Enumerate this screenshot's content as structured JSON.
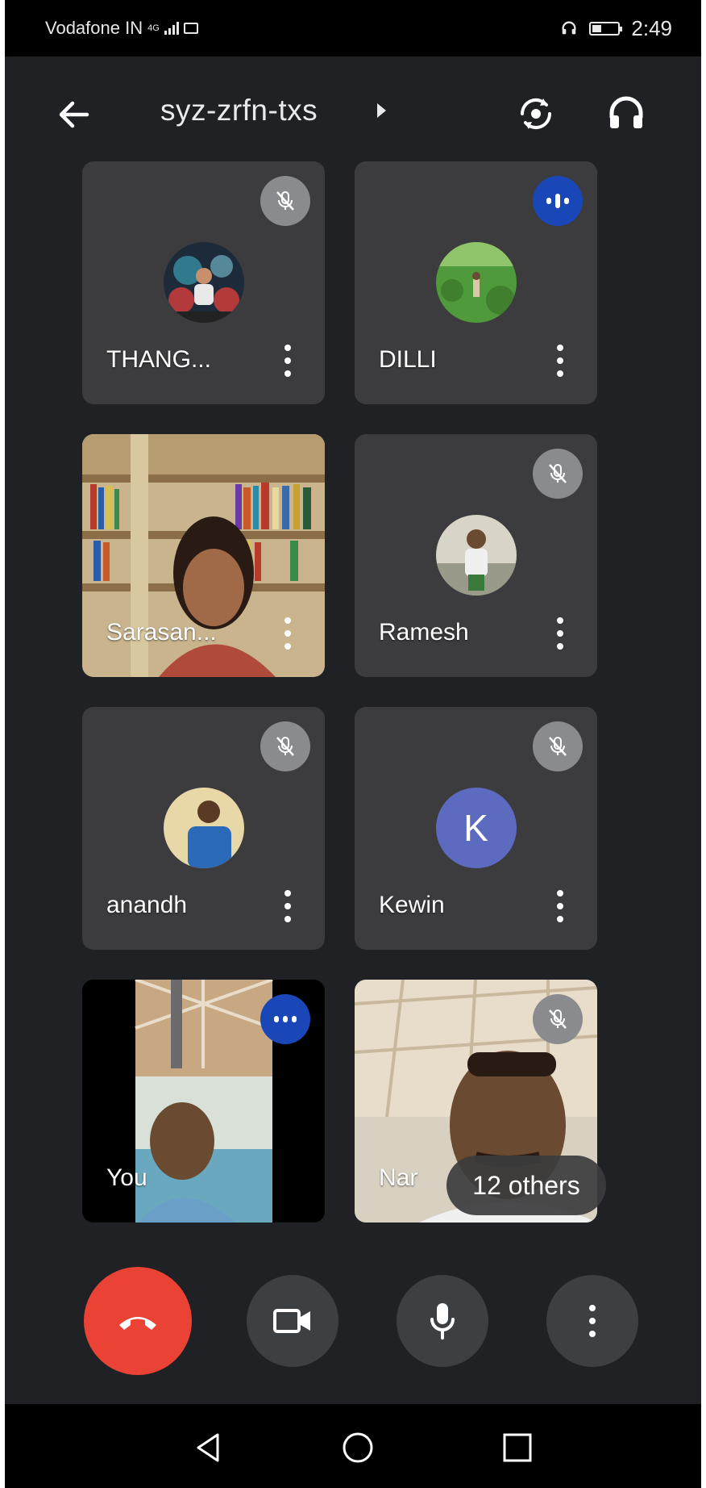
{
  "status_bar": {
    "carrier": "Vodafone IN",
    "network_type": "4G",
    "time": "2:49",
    "battery_level": 0.35
  },
  "top_bar": {
    "meeting_code": "syz-zrfn-txs",
    "icons": [
      "back-arrow-icon",
      "switch-camera-icon",
      "audio-output-icon"
    ]
  },
  "participants": [
    {
      "name": "THANG...",
      "status": "muted",
      "media": "profile-photo"
    },
    {
      "name": "DILLI",
      "status": "speaking",
      "media": "profile-photo"
    },
    {
      "name": "Sarasan...",
      "status": "unmuted",
      "media": "video"
    },
    {
      "name": "Ramesh",
      "status": "muted",
      "media": "profile-photo"
    },
    {
      "name": "anandh",
      "status": "muted",
      "media": "profile-photo"
    },
    {
      "name": "Kewin",
      "status": "muted",
      "media": "letter-avatar",
      "initial": "K",
      "avatar_color": "#5c6bc0"
    },
    {
      "name": "You",
      "status": "speaking",
      "media": "video"
    },
    {
      "name": "Nar",
      "status": "muted",
      "media": "video"
    }
  ],
  "others_chip": "12 others",
  "controls": [
    "end-call",
    "camera",
    "microphone",
    "more-options"
  ],
  "colors": {
    "background": "#202124",
    "tile": "#3c3c3e",
    "end_call": "#ea4335",
    "speaking_badge": "#1a47b8",
    "muted_badge": "#8a8b8e"
  }
}
